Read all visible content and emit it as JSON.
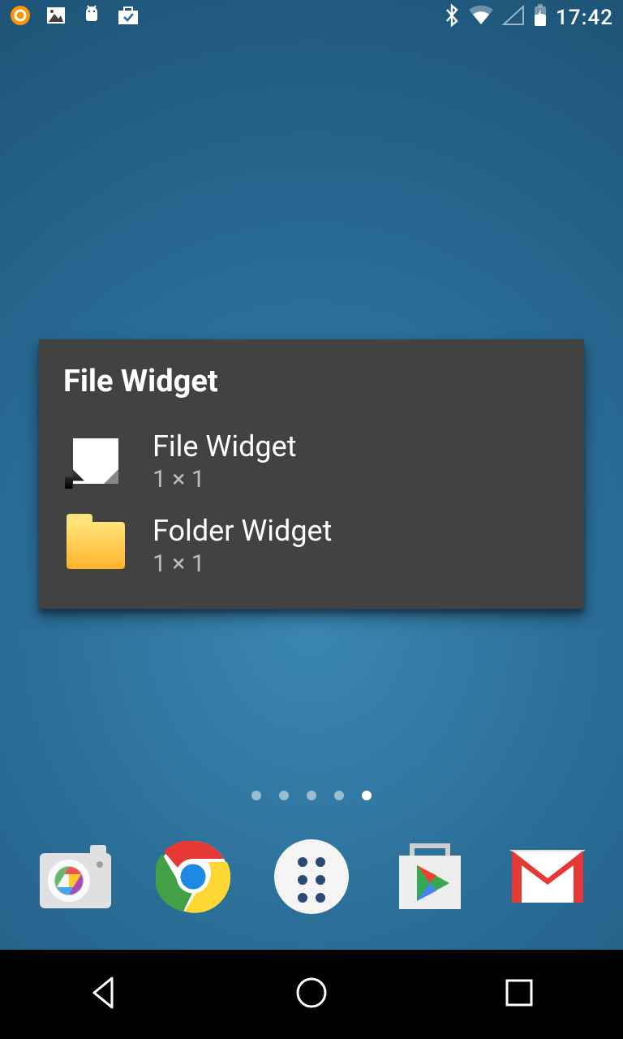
{
  "status": {
    "time": "17:42",
    "left_icons": [
      "avast-icon",
      "gallery-icon",
      "android-debug-icon",
      "briefcase-check-icon"
    ],
    "right_icons": [
      "bluetooth-icon",
      "wifi-icon",
      "cell-signal-icon",
      "battery-charging-icon"
    ]
  },
  "widget_picker": {
    "group_title": "File Widget",
    "items": [
      {
        "name": "File Widget",
        "size": "1 × 1",
        "icon": "file-shortcut"
      },
      {
        "name": "Folder Widget",
        "size": "1 × 1",
        "icon": "folder"
      }
    ]
  },
  "page_indicator": {
    "count": 5,
    "active_index": 4
  },
  "dock": {
    "apps": [
      "camera",
      "chrome",
      "app-drawer",
      "play-store",
      "gmail"
    ]
  }
}
